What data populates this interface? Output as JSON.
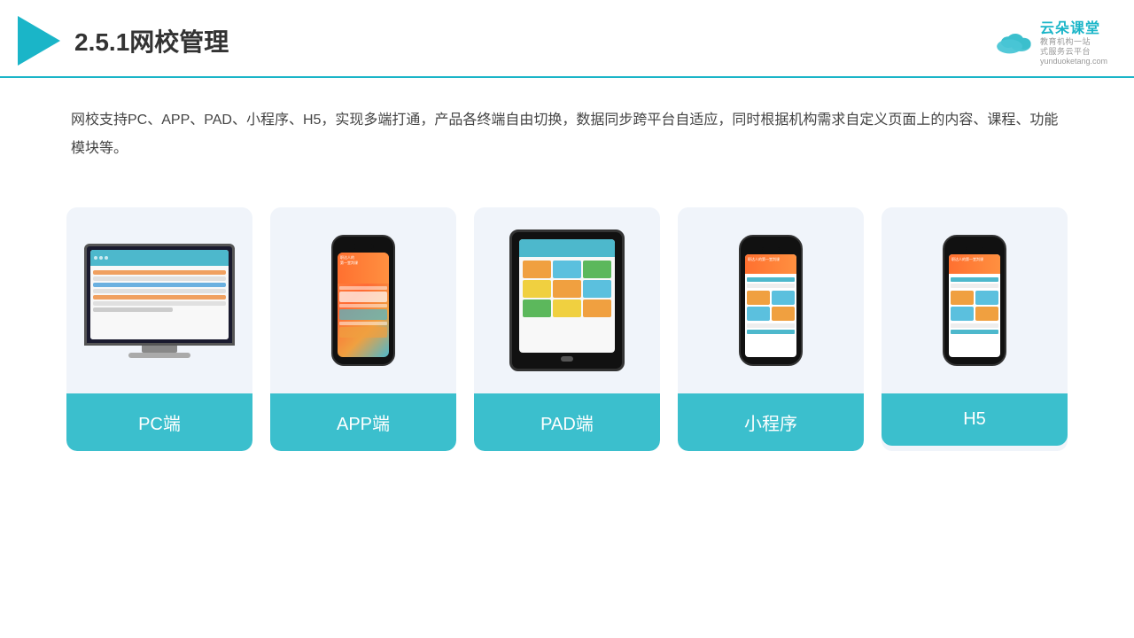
{
  "header": {
    "title": "2.5.1网校管理",
    "brand": {
      "name": "云朵课堂",
      "url": "yunduoketang.com",
      "tagline": "教育机构一站\n式服务云平台"
    }
  },
  "description": "网校支持PC、APP、PAD、小程序、H5，实现多端打通，产品各终端自由切换，数据同步跨平台自适应，同时根据机构需求自定义页面上的内容、课程、功能模块等。",
  "cards": [
    {
      "id": "pc",
      "label": "PC端"
    },
    {
      "id": "app",
      "label": "APP端"
    },
    {
      "id": "pad",
      "label": "PAD端"
    },
    {
      "id": "mini",
      "label": "小程序"
    },
    {
      "id": "h5",
      "label": "H5"
    }
  ],
  "colors": {
    "accent": "#3bbfcd",
    "headerBorder": "#1ab5c8"
  }
}
